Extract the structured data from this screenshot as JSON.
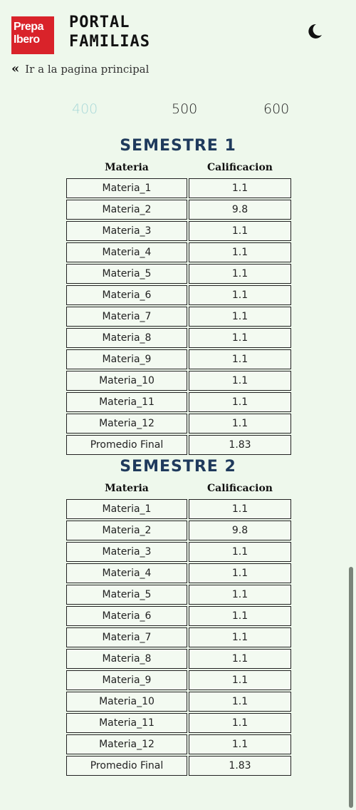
{
  "header": {
    "logo_line1": "Prepa",
    "logo_line2": "Ibero",
    "title_line1": "PORTAL",
    "title_line2": "FAMILIAS",
    "theme_icon": "moon-icon",
    "back_link": "Ir a la pagina principal"
  },
  "years": {
    "tabs": [
      "400",
      "500",
      "600"
    ],
    "active": "400"
  },
  "columns": {
    "subject": "Materia",
    "grade": "Calificacion"
  },
  "semesters": [
    {
      "title": "SEMESTRE 1",
      "rows": [
        {
          "subject": "Materia_1",
          "grade": "1.1"
        },
        {
          "subject": "Materia_2",
          "grade": "9.8"
        },
        {
          "subject": "Materia_3",
          "grade": "1.1"
        },
        {
          "subject": "Materia_4",
          "grade": "1.1"
        },
        {
          "subject": "Materia_5",
          "grade": "1.1"
        },
        {
          "subject": "Materia_6",
          "grade": "1.1"
        },
        {
          "subject": "Materia_7",
          "grade": "1.1"
        },
        {
          "subject": "Materia_8",
          "grade": "1.1"
        },
        {
          "subject": "Materia_9",
          "grade": "1.1"
        },
        {
          "subject": "Materia_10",
          "grade": "1.1"
        },
        {
          "subject": "Materia_11",
          "grade": "1.1"
        },
        {
          "subject": "Materia_12",
          "grade": "1.1"
        },
        {
          "subject": "Promedio Final",
          "grade": "1.83"
        }
      ]
    },
    {
      "title": "SEMESTRE 2",
      "rows": [
        {
          "subject": "Materia_1",
          "grade": "1.1"
        },
        {
          "subject": "Materia_2",
          "grade": "9.8"
        },
        {
          "subject": "Materia_3",
          "grade": "1.1"
        },
        {
          "subject": "Materia_4",
          "grade": "1.1"
        },
        {
          "subject": "Materia_5",
          "grade": "1.1"
        },
        {
          "subject": "Materia_6",
          "grade": "1.1"
        },
        {
          "subject": "Materia_7",
          "grade": "1.1"
        },
        {
          "subject": "Materia_8",
          "grade": "1.1"
        },
        {
          "subject": "Materia_9",
          "grade": "1.1"
        },
        {
          "subject": "Materia_10",
          "grade": "1.1"
        },
        {
          "subject": "Materia_11",
          "grade": "1.1"
        },
        {
          "subject": "Materia_12",
          "grade": "1.1"
        },
        {
          "subject": "Promedio Final",
          "grade": "1.83"
        }
      ]
    }
  ],
  "colors": {
    "background": "#eef8ec",
    "logo_red": "#d9232a",
    "semester_title": "#1f3a5c",
    "active_tab": "#a8d8d8"
  }
}
